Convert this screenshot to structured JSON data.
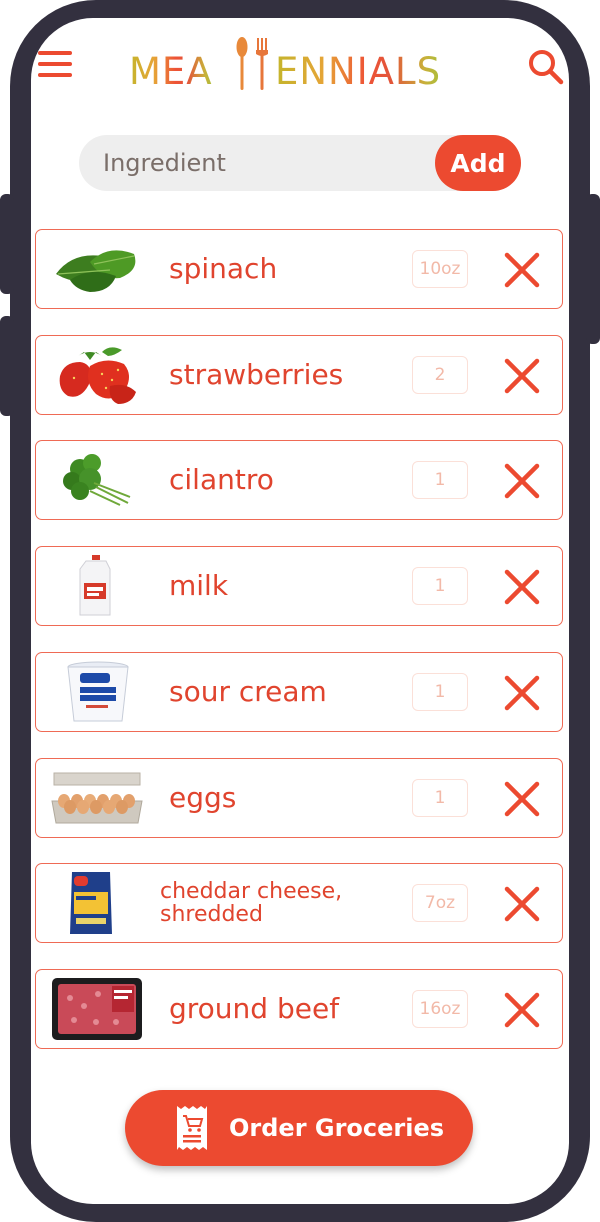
{
  "app": {
    "logo_text_left": "MEA",
    "logo_text_right": "ENNIALS"
  },
  "search": {
    "placeholder": "Ingredient",
    "add_label": "Add"
  },
  "items": [
    {
      "name": "spinach",
      "qty": "10oz",
      "icon": "spinach-image"
    },
    {
      "name": "strawberries",
      "qty": "2",
      "icon": "strawberries-image"
    },
    {
      "name": "cilantro",
      "qty": "1",
      "icon": "cilantro-image"
    },
    {
      "name": "milk",
      "qty": "1",
      "icon": "milk-jug-image"
    },
    {
      "name": "sour cream",
      "qty": "1",
      "icon": "sour-cream-tub-image"
    },
    {
      "name": "eggs",
      "qty": "1",
      "icon": "egg-carton-image"
    },
    {
      "name": "cheddar cheese, shredded",
      "qty": "7oz",
      "icon": "cheese-bag-image"
    },
    {
      "name": "ground beef",
      "qty": "16oz",
      "icon": "ground-beef-pack-image"
    }
  ],
  "order": {
    "label": "Order Groceries"
  },
  "colors": {
    "accent": "#ec4a30",
    "frame": "#33303f",
    "row_border": "#ef6a55",
    "qty_text": "#f2b9a8"
  }
}
